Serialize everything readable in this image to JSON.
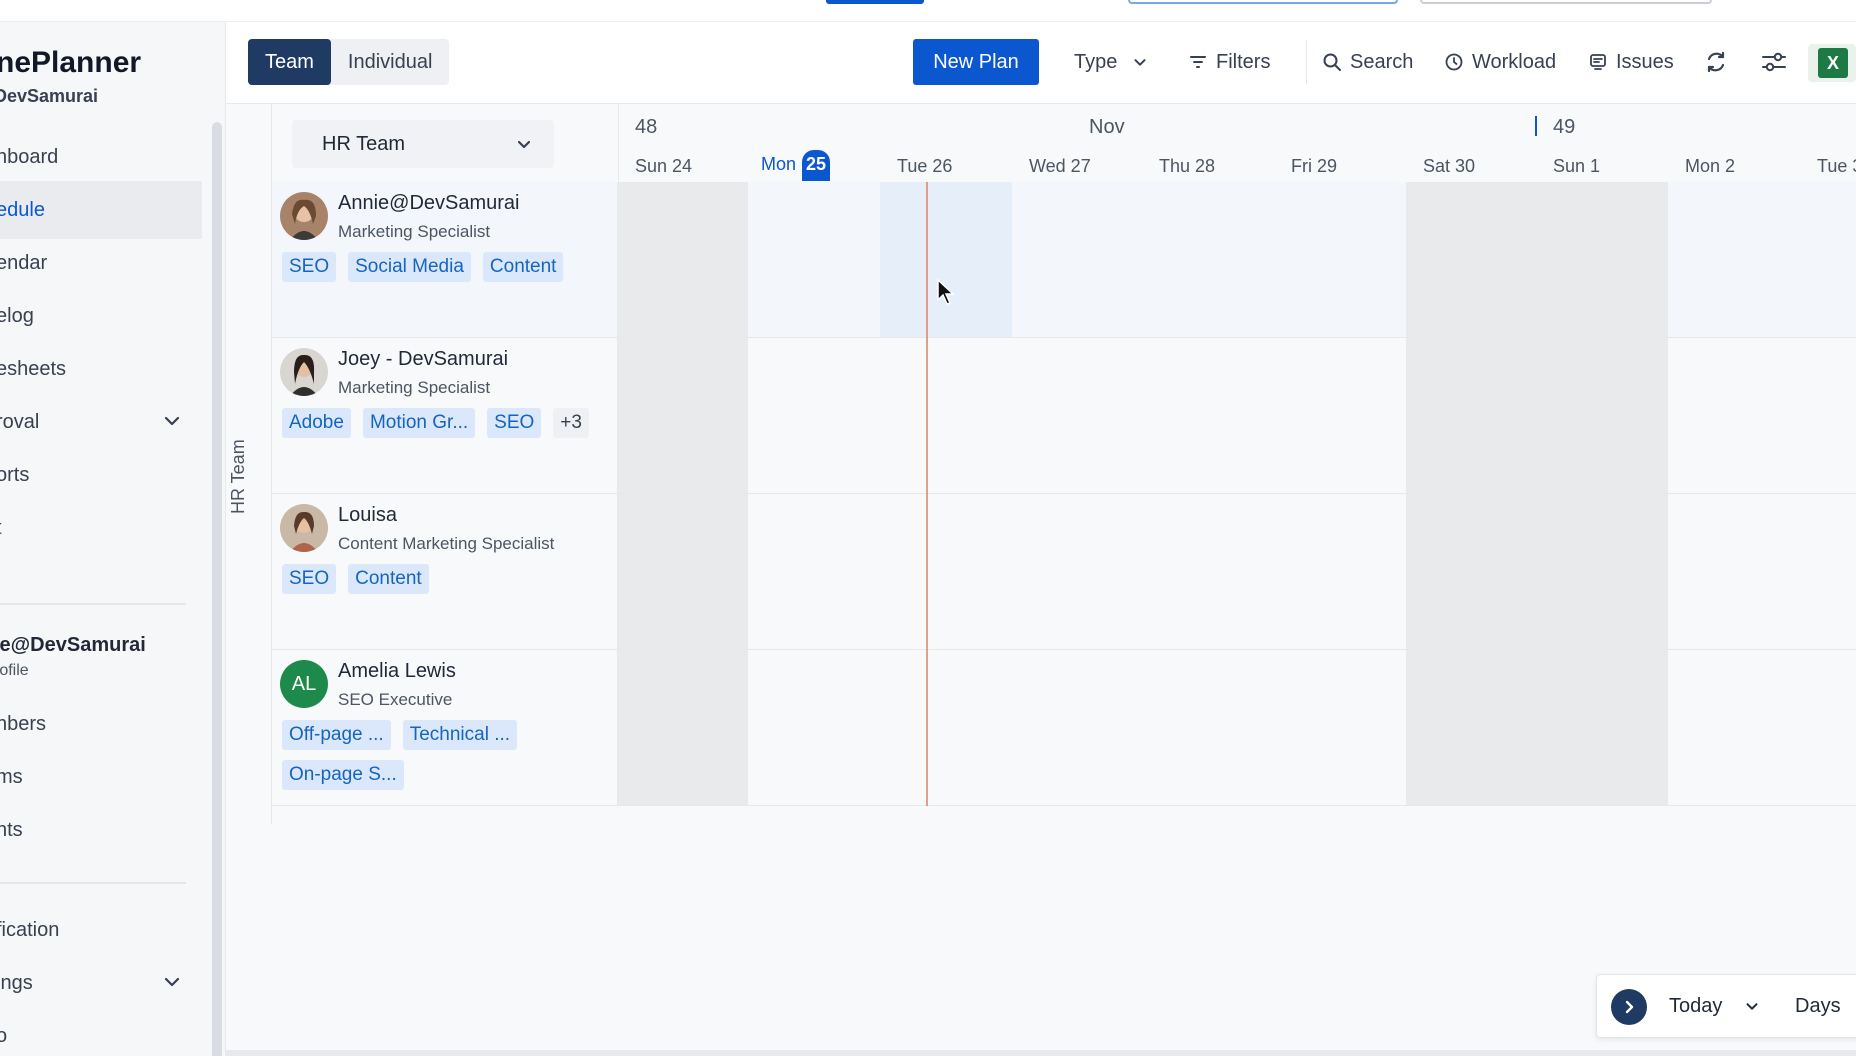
{
  "brand": {
    "title": "nePlanner",
    "subtitle": "DevSamurai"
  },
  "sidebar": {
    "items": [
      {
        "label": "hboard",
        "active": false
      },
      {
        "label": "edule",
        "active": true
      },
      {
        "label": "endar",
        "active": false
      },
      {
        "label": "elog",
        "active": false
      },
      {
        "label": "esheets",
        "active": false
      },
      {
        "label": "roval",
        "active": false,
        "expandable": true
      },
      {
        "label": "orts",
        "active": false
      },
      {
        "label": "t",
        "active": false
      }
    ],
    "user": {
      "name": "ie@DevSamurai",
      "sub": "rofile"
    },
    "items2": [
      {
        "label": "nbers"
      },
      {
        "label": "ms"
      },
      {
        "label": "nts"
      }
    ],
    "items3": [
      {
        "label": "fication"
      },
      {
        "label": "ings",
        "expandable": true
      },
      {
        "label": "o"
      }
    ]
  },
  "toolbar": {
    "tab_team": "Team",
    "tab_individual": "Individual",
    "new_plan": "New Plan",
    "type": "Type",
    "filters": "Filters",
    "search": "Search",
    "workload": "Workload",
    "issues": "Issues"
  },
  "team_select": "HR Team",
  "group_label": "HR Team",
  "calendar": {
    "week_start": "48",
    "week_next": "49",
    "month": "Nov",
    "days": [
      "Sun 24",
      "Mon",
      "Tue 26",
      "Wed 27",
      "Thu 28",
      "Fri 29",
      "Sat 30",
      "Sun 1",
      "Mon 2",
      "Tue 3"
    ],
    "today_num": "25"
  },
  "people": [
    {
      "name": "Annie@DevSamurai",
      "role": "Marketing Specialist",
      "tags": [
        "SEO",
        "Social Media",
        "Content"
      ],
      "more": ""
    },
    {
      "name": "Joey - DevSamurai",
      "role": "Marketing Specialist",
      "tags": [
        "Adobe",
        "Motion Gr...",
        "SEO"
      ],
      "more": "+3"
    },
    {
      "name": "Louisa",
      "role": "Content Marketing Specialist",
      "tags": [
        "SEO",
        "Content"
      ],
      "more": ""
    },
    {
      "name": "Amelia Lewis",
      "role": "SEO Executive",
      "initials": "AL",
      "tags": [
        "Off-page ...",
        "Technical ...",
        "On-page S..."
      ],
      "more": ""
    }
  ],
  "bottom": {
    "today": "Today",
    "days": "Days"
  },
  "colors": {
    "accent": "#0b57d0",
    "navy": "#1f3a63",
    "tag_bg": "#dbe8fb",
    "tag_fg": "#1565c0"
  }
}
